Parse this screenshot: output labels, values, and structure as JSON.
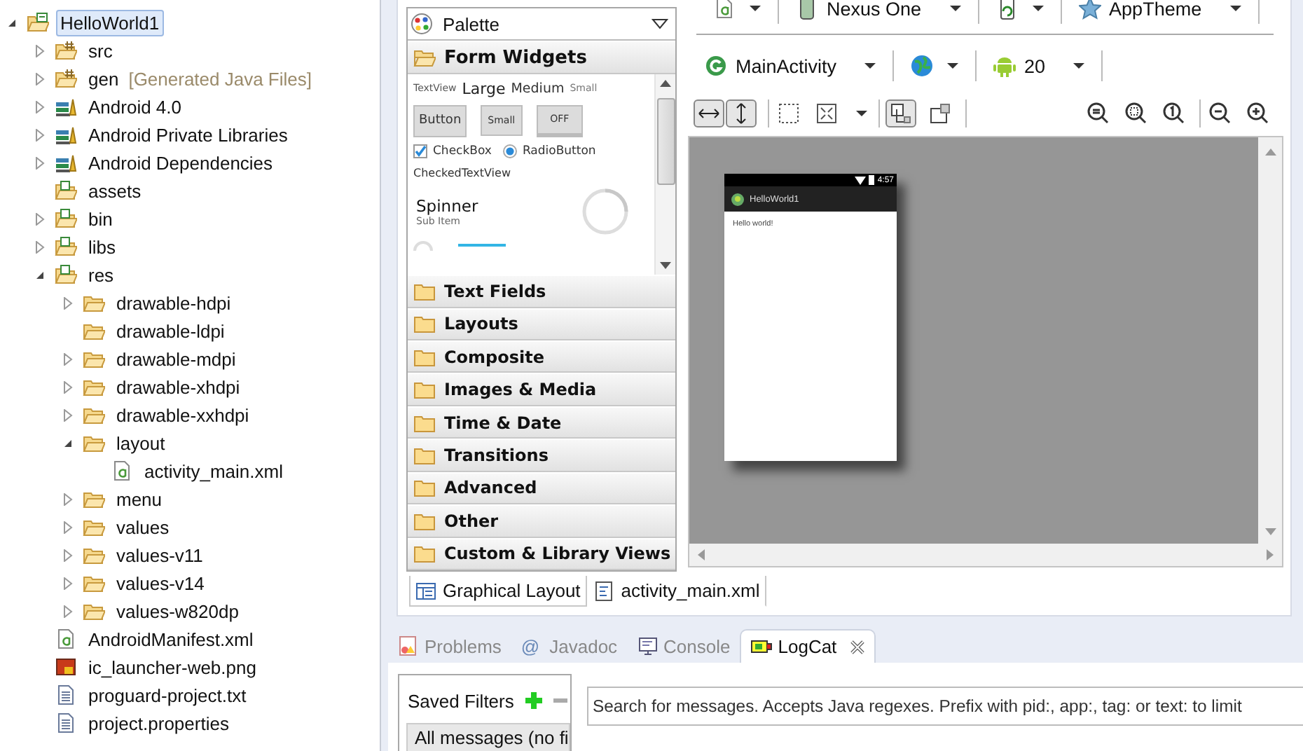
{
  "project_tree": {
    "items": [
      {
        "label": "HelloWorld1",
        "kind": "project",
        "expanded": true,
        "selected": true,
        "children": [
          {
            "label": "src",
            "kind": "source-folder",
            "expanded": false,
            "selected": false
          },
          {
            "label": "gen",
            "decoration": "[Generated Java Files]",
            "kind": "source-folder",
            "expanded": false,
            "selected": false
          },
          {
            "label": "Android 4.0",
            "kind": "library",
            "expanded": false,
            "selected": false
          },
          {
            "label": "Android Private Libraries",
            "kind": "library",
            "expanded": false,
            "selected": false
          },
          {
            "label": "Android Dependencies",
            "kind": "library",
            "expanded": false,
            "selected": false
          },
          {
            "label": "assets",
            "kind": "project-folder",
            "selected": false
          },
          {
            "label": "bin",
            "kind": "project-folder",
            "expanded": false,
            "selected": false
          },
          {
            "label": "libs",
            "kind": "project-folder",
            "expanded": false,
            "selected": false
          },
          {
            "label": "res",
            "kind": "project-folder",
            "expanded": true,
            "selected": false,
            "children": [
              {
                "label": "drawable-hdpi",
                "kind": "folder",
                "expanded": false,
                "selected": false
              },
              {
                "label": "drawable-ldpi",
                "kind": "folder",
                "selected": false
              },
              {
                "label": "drawable-mdpi",
                "kind": "folder",
                "expanded": false,
                "selected": false
              },
              {
                "label": "drawable-xhdpi",
                "kind": "folder",
                "expanded": false,
                "selected": false
              },
              {
                "label": "drawable-xxhdpi",
                "kind": "folder",
                "expanded": false,
                "selected": false
              },
              {
                "label": "layout",
                "kind": "folder",
                "expanded": true,
                "selected": false,
                "children": [
                  {
                    "label": "activity_main.xml",
                    "kind": "xml-file",
                    "selected": false
                  }
                ]
              },
              {
                "label": "menu",
                "kind": "folder",
                "expanded": false,
                "selected": false
              },
              {
                "label": "values",
                "kind": "folder",
                "expanded": false,
                "selected": false
              },
              {
                "label": "values-v11",
                "kind": "folder",
                "expanded": false,
                "selected": false
              },
              {
                "label": "values-v14",
                "kind": "folder",
                "expanded": false,
                "selected": false
              },
              {
                "label": "values-w820dp",
                "kind": "folder",
                "expanded": false,
                "selected": false
              }
            ]
          },
          {
            "label": "AndroidManifest.xml",
            "kind": "xml-file",
            "selected": false
          },
          {
            "label": "ic_launcher-web.png",
            "kind": "image-file",
            "selected": false
          },
          {
            "label": "proguard-project.txt",
            "kind": "text-file",
            "selected": false
          },
          {
            "label": "project.properties",
            "kind": "text-file",
            "selected": false
          }
        ]
      }
    ]
  },
  "palette": {
    "title": "Palette",
    "categories": [
      {
        "label": "Form Widgets",
        "expanded": true
      },
      {
        "label": "Text Fields",
        "expanded": false
      },
      {
        "label": "Layouts",
        "expanded": false
      },
      {
        "label": "Composite",
        "expanded": false
      },
      {
        "label": "Images & Media",
        "expanded": false
      },
      {
        "label": "Time & Date",
        "expanded": false
      },
      {
        "label": "Transitions",
        "expanded": false
      },
      {
        "label": "Advanced",
        "expanded": false
      },
      {
        "label": "Other",
        "expanded": false
      },
      {
        "label": "Custom & Library Views",
        "expanded": false
      }
    ],
    "form_widgets": {
      "text_views": [
        "TextView",
        "Large",
        "Medium",
        "Small"
      ],
      "buttons": [
        {
          "label": "Button",
          "kind": "button"
        },
        {
          "label": "Small",
          "kind": "small-button"
        },
        {
          "label": "OFF",
          "kind": "toggle"
        }
      ],
      "checkbox": {
        "label": "CheckBox",
        "checked": true
      },
      "radio": {
        "label": "RadioButton",
        "selected": true
      },
      "checked_text_view": "CheckedTextView",
      "spinner": {
        "title": "Spinner",
        "subtitle": "Sub Item"
      }
    }
  },
  "editor_toolbar": {
    "rows": [
      [
        {
          "kind": "file"
        },
        {
          "kind": "device",
          "label": "Nexus One"
        },
        {
          "kind": "orientation"
        },
        {
          "kind": "theme",
          "label": "AppTheme"
        }
      ],
      [
        {
          "kind": "activity",
          "label": "MainActivity"
        },
        {
          "kind": "locale"
        },
        {
          "kind": "api",
          "label": "20"
        }
      ]
    ],
    "view_controls": [
      [
        {
          "kind": "fill-width",
          "pressed": true
        },
        {
          "kind": "fill-height",
          "pressed": true
        }
      ],
      [
        {
          "kind": "emulate-size",
          "pressed": false
        },
        {
          "kind": "fit-screen",
          "pressed": false,
          "dropdown": true
        }
      ],
      [
        {
          "kind": "layout-mode",
          "pressed": true
        },
        {
          "kind": "clip-mode",
          "pressed": false
        }
      ]
    ],
    "zoom_controls": [
      [
        {
          "kind": "zoom-fit"
        },
        {
          "kind": "zoom-real"
        },
        {
          "kind": "zoom-100"
        }
      ],
      [
        {
          "kind": "zoom-out"
        },
        {
          "kind": "zoom-in"
        }
      ]
    ]
  },
  "preview": {
    "time": "4:57",
    "app_title": "HelloWorld1",
    "content": "Hello world!"
  },
  "editor_tabs": [
    {
      "label": "Graphical Layout",
      "kind": "layout",
      "selected": true
    },
    {
      "label": "activity_main.xml",
      "kind": "xml",
      "selected": false
    }
  ],
  "bottom_tabs": [
    {
      "label": "Problems",
      "kind": "problems",
      "selected": false
    },
    {
      "label": "Javadoc",
      "kind": "javadoc",
      "icon_text": "@",
      "selected": false
    },
    {
      "label": "Console",
      "kind": "console",
      "selected": false
    },
    {
      "label": "LogCat",
      "kind": "logcat",
      "selected": true,
      "closable": true
    }
  ],
  "logcat": {
    "saved_filters": {
      "title": "Saved Filters",
      "filters": [
        {
          "label": "All messages (no fi",
          "selected": true
        }
      ]
    },
    "search": {
      "placeholder": "Search for messages. Accepts Java regexes. Prefix with pid:, app:, tag: or text: to limit"
    }
  }
}
